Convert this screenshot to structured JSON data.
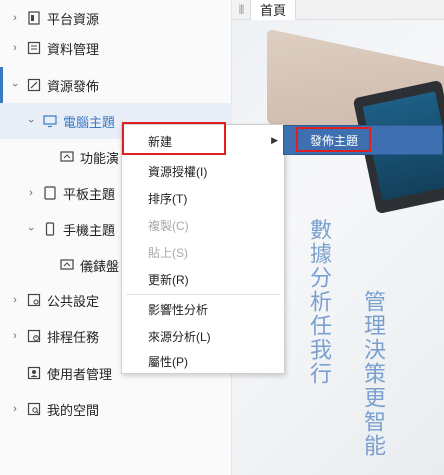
{
  "sidebar": {
    "items": [
      {
        "label": "平台資源"
      },
      {
        "label": "資料管理"
      },
      {
        "label": "資源發佈"
      },
      {
        "label": "電腦主題"
      },
      {
        "label": "功能演"
      },
      {
        "label": "平板主題"
      },
      {
        "label": "手機主題"
      },
      {
        "label": "儀錶盤"
      },
      {
        "label": "公共設定"
      },
      {
        "label": "排程任務"
      },
      {
        "label": "使用者管理"
      },
      {
        "label": "我的空間"
      }
    ]
  },
  "tabs": {
    "items": [
      {
        "label": "首頁"
      }
    ]
  },
  "content": {
    "slogan_line1": "數據分析任我行",
    "slogan_line2": "管理決策更智能"
  },
  "context_menu": {
    "items": [
      {
        "label": "新建",
        "enabled": true,
        "has_submenu": true
      },
      {
        "label": "資源授權(I)",
        "enabled": true
      },
      {
        "label": "排序(T)",
        "enabled": true
      },
      {
        "label": "複製(C)",
        "enabled": false
      },
      {
        "label": "貼上(S)",
        "enabled": false
      },
      {
        "label": "更新(R)",
        "enabled": true
      },
      {
        "label": "影響性分析",
        "enabled": true
      },
      {
        "label": "來源分析(L)",
        "enabled": true
      },
      {
        "label": "屬性(P)",
        "enabled": true
      }
    ]
  },
  "submenu": {
    "items": [
      {
        "label": "發佈主題"
      }
    ]
  },
  "colors": {
    "accent": "#3a78c2",
    "highlight_border": "#e02020",
    "submenu_bg": "#3e6fb0",
    "slogan": "#7ba0cf"
  },
  "icons": {
    "platform": "platform-resource-icon",
    "data": "data-management-icon",
    "publish": "resource-publish-icon",
    "computer": "monitor-icon",
    "dashboard": "dashboard-icon",
    "tablet": "tablet-icon",
    "phone": "phone-icon",
    "settings": "public-settings-icon",
    "schedule": "schedule-icon",
    "users": "user-management-icon",
    "space": "my-space-icon"
  }
}
